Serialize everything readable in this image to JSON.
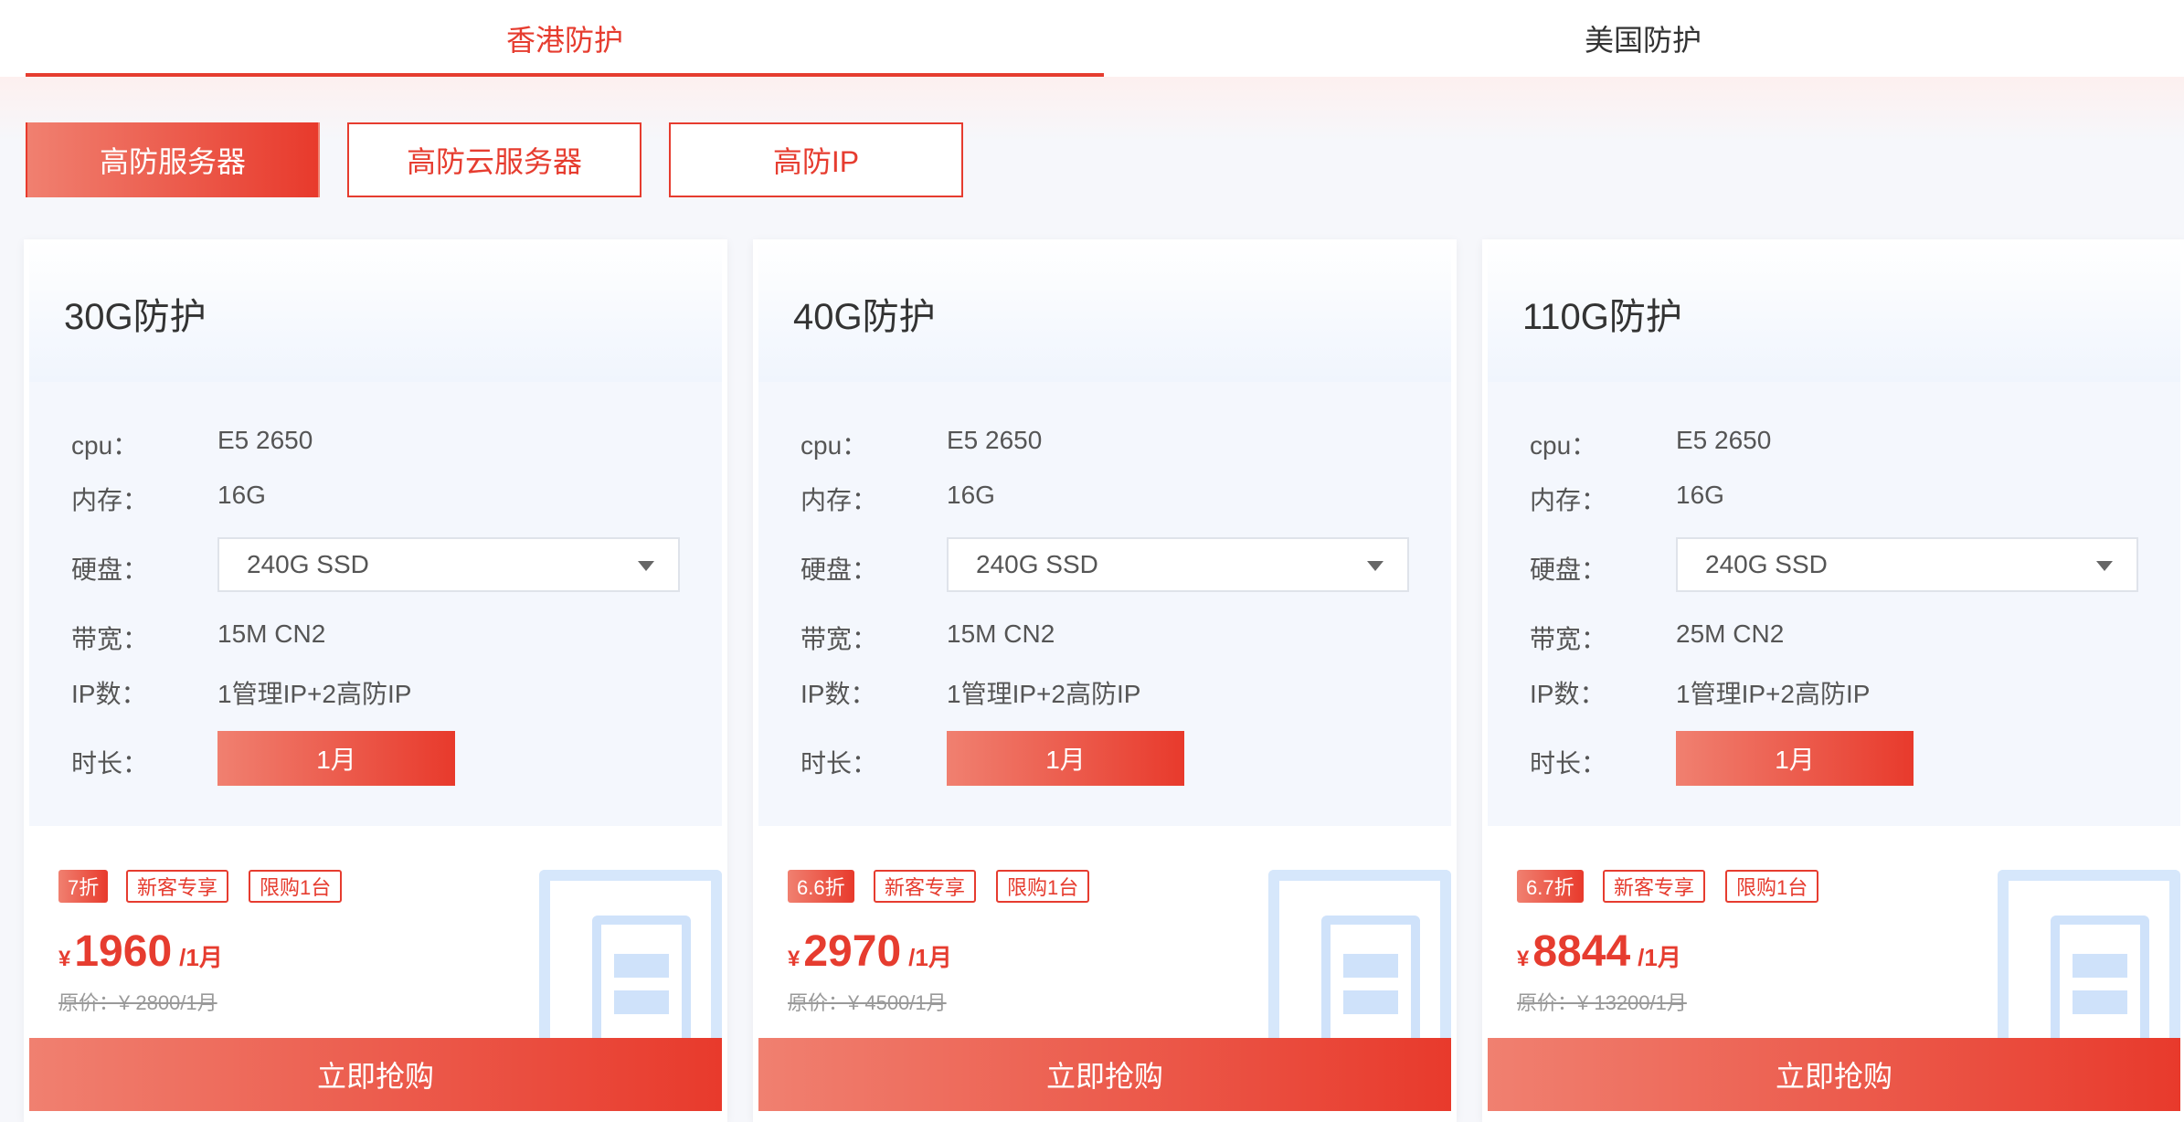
{
  "region_tabs": [
    {
      "label": "香港防护",
      "active": true
    },
    {
      "label": "美国防护",
      "active": false
    }
  ],
  "type_tabs": [
    {
      "label": "高防服务器",
      "active": true
    },
    {
      "label": "高防云服务器",
      "active": false
    },
    {
      "label": "高防IP",
      "active": false
    }
  ],
  "spec_labels": {
    "cpu": "cpu：",
    "memory": "内存：",
    "disk": "硬盘：",
    "bandwidth": "带宽：",
    "ip_count": "IP数：",
    "duration": "时长："
  },
  "tags": {
    "new_customer": "新客专享",
    "limit": "限购1台"
  },
  "cards": [
    {
      "title": "30G防护",
      "cpu": "E5 2650",
      "memory": "16G",
      "disk": "240G SSD",
      "bandwidth": "15M CN2",
      "ip_count": "1管理IP+2高防IP",
      "duration": "1月",
      "discount": "7折",
      "currency": "¥",
      "price": "1960",
      "price_unit": "/1月",
      "original_price": "原价：¥ 2800/1月",
      "buy_label": "立即抢购"
    },
    {
      "title": "40G防护",
      "cpu": "E5 2650",
      "memory": "16G",
      "disk": "240G SSD",
      "bandwidth": "15M CN2",
      "ip_count": "1管理IP+2高防IP",
      "duration": "1月",
      "discount": "6.6折",
      "currency": "¥",
      "price": "2970",
      "price_unit": "/1月",
      "original_price": "原价：¥ 4500/1月",
      "buy_label": "立即抢购"
    },
    {
      "title": "110G防护",
      "cpu": "E5 2650",
      "memory": "16G",
      "disk": "240G SSD",
      "bandwidth": "25M CN2",
      "ip_count": "1管理IP+2高防IP",
      "duration": "1月",
      "discount": "6.7折",
      "currency": "¥",
      "price": "8844",
      "price_unit": "/1月",
      "original_price": "原价：¥ 13200/1月",
      "buy_label": "立即抢购"
    }
  ],
  "colors": {
    "accent": "#e63c2f",
    "gradient_start": "#f08070",
    "gradient_end": "#e83a2c",
    "card_body_bg": "#f4f7fd"
  }
}
